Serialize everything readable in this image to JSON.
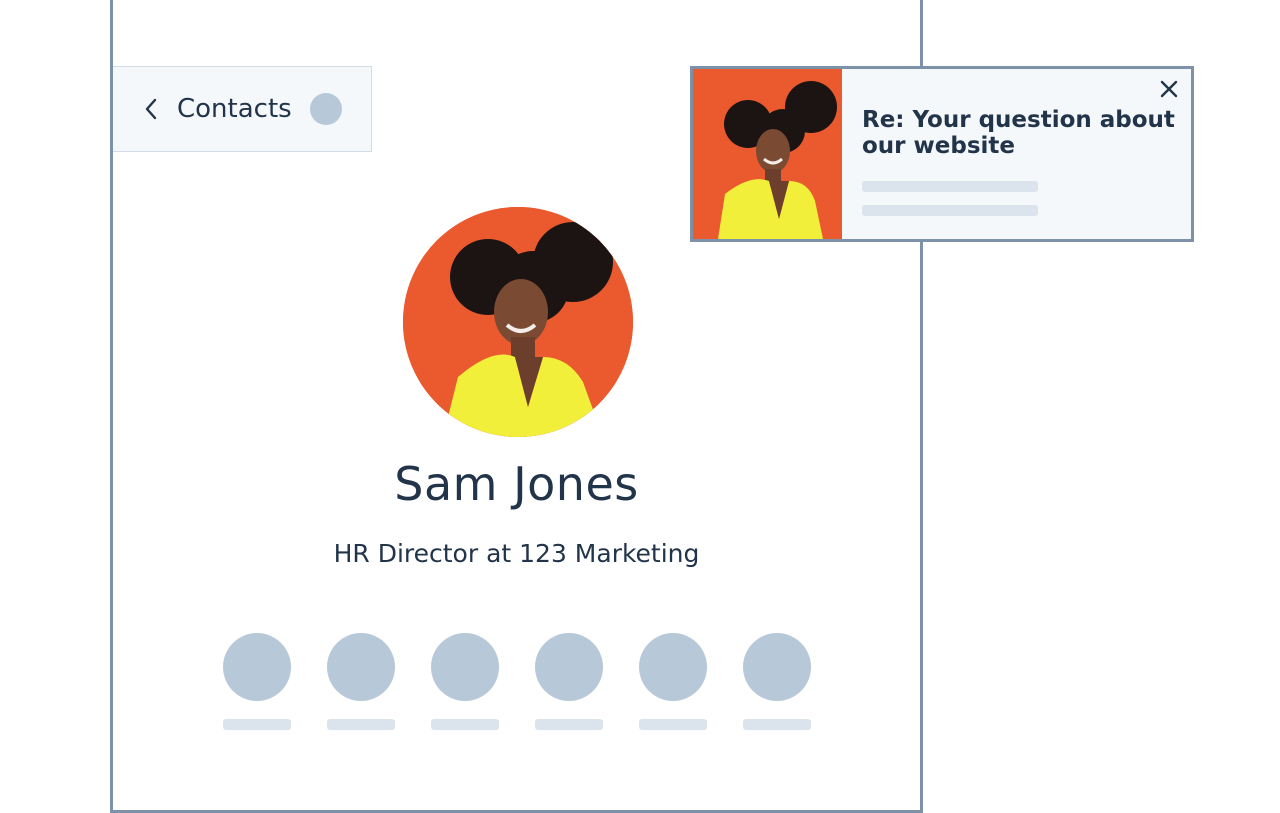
{
  "contacts_nav": {
    "back_icon": "chevron-left-icon",
    "label": "Contacts"
  },
  "contact": {
    "name": "Sam Jones",
    "title": "HR Director at 123 Marketing",
    "action_count": 6
  },
  "notification": {
    "title": "Re: Your question about our website",
    "close_icon": "close-icon"
  },
  "colors": {
    "text": "#22344a",
    "border": "#7d91a9",
    "placeholder": "#b7c8d8",
    "placeholder_light": "#dbe4ec",
    "photo_background": "#ea5a2e",
    "jacket": "#f2ef3a"
  }
}
